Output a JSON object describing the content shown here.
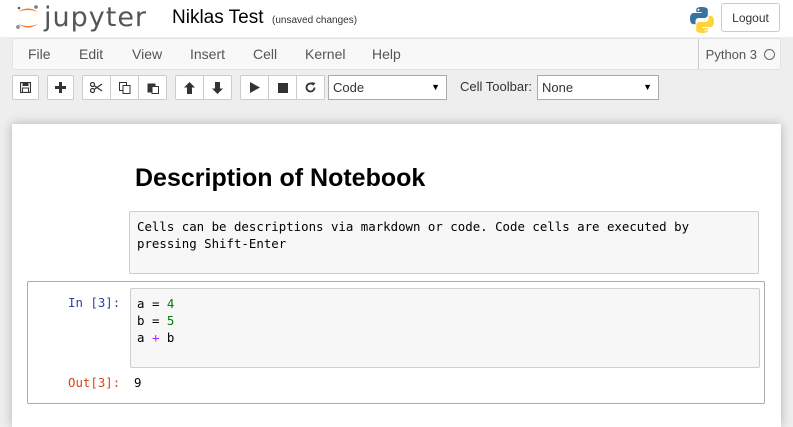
{
  "header": {
    "logo_text": "jupyter",
    "notebook_title": "Niklas Test",
    "save_status": "(unsaved changes)",
    "logout_label": "Logout"
  },
  "menubar": {
    "items": [
      "File",
      "Edit",
      "View",
      "Insert",
      "Cell",
      "Kernel",
      "Help"
    ],
    "kernel_name": "Python 3"
  },
  "toolbar": {
    "buttons": [
      "save-icon",
      "plus-icon",
      "scissors-icon",
      "copy-icon",
      "paste-icon",
      "arrow-up-icon",
      "arrow-down-icon",
      "play-icon",
      "stop-icon",
      "restart-icon"
    ],
    "cell_type": "Code",
    "cell_toolbar_label": "Cell Toolbar:",
    "cell_toolbar_value": "None"
  },
  "cells": {
    "markdown_heading": "Description of Notebook",
    "markdown_source": "Cells can be descriptions via markdown or code. Code cells are executed by pressing Shift-Enter",
    "code": {
      "in_prompt": "In [3]:",
      "lines": [
        {
          "var": "a",
          "op": "=",
          "val": "4"
        },
        {
          "var": "b",
          "op": "=",
          "val": "5"
        },
        {
          "var": "a",
          "op": "+",
          "val": "b"
        }
      ],
      "out_prompt": "Out[3]:",
      "output": "9"
    }
  },
  "colors": {
    "logo_orange": "#F37726",
    "number_green": "#008000",
    "operator_purple": "#AA22FF",
    "in_prompt_blue": "#303F9F",
    "out_prompt_red": "#D84315"
  }
}
